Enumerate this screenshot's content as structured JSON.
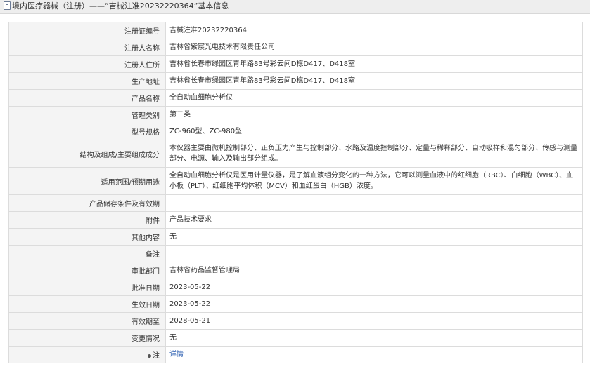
{
  "header": {
    "icon": "document-icon",
    "title": "境内医疗器械（注册）——“吉械注准20232220364”基本信息"
  },
  "rows": [
    {
      "label": "注册证编号",
      "value": "吉械注准20232220364"
    },
    {
      "label": "注册人名称",
      "value": "吉林省紫宸光电技术有限责任公司"
    },
    {
      "label": "注册人住所",
      "value": "吉林省长春市绿园区青年路83号彩云间D栋D417、D418室"
    },
    {
      "label": "生产地址",
      "value": "吉林省长春市绿园区青年路83号彩云间D栋D417、D418室"
    },
    {
      "label": "产品名称",
      "value": "全自动血细胞分析仪"
    },
    {
      "label": "管理类别",
      "value": "第二类"
    },
    {
      "label": "型号规格",
      "value": "ZC-960型、ZC-980型"
    },
    {
      "label": "结构及组成/主要组成成分",
      "value": "本仪器主要由微机控制部分、正负压力产生与控制部分、水路及温度控制部分、定量与稀释部分、自动吸样和混匀部分、传感与测量部分、电源、输入及输出部分组成。"
    },
    {
      "label": "适用范围/预期用途",
      "value": "全自动血细胞分析仪是医用计量仪器，是了解血液组分变化的一种方法，它可以测量血液中的红细胞（RBC）、白细胞（WBC）、血小板（PLT）、红细胞平均体积（MCV）和血红蛋白（HGB）浓度。"
    },
    {
      "label": "产品储存条件及有效期",
      "value": ""
    },
    {
      "label": "附件",
      "value": "产品技术要求"
    },
    {
      "label": "其他内容",
      "value": "无"
    },
    {
      "label": "备注",
      "value": ""
    },
    {
      "label": "审批部门",
      "value": "吉林省药品监督管理局"
    },
    {
      "label": "批准日期",
      "value": "2023-05-22"
    },
    {
      "label": "生效日期",
      "value": "2023-05-22"
    },
    {
      "label": "有效期至",
      "value": "2028-05-21"
    },
    {
      "label": "变更情况",
      "value": "无"
    }
  ],
  "note_row": {
    "icon": "pin-icon",
    "label": "注",
    "link": "详情"
  }
}
